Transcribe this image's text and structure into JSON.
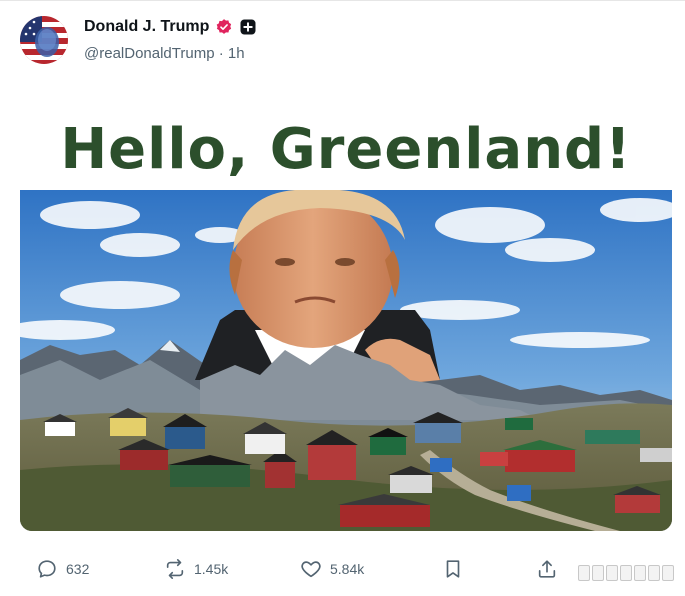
{
  "post": {
    "author": {
      "display_name": "Donald J. Trump",
      "handle": "@realDonaldTrump",
      "separator": "·",
      "time": "1h",
      "avatar_icon": "flag-portrait-avatar",
      "verified_icon": "verified-badge-icon",
      "extra_badge_icon": "plus-badge-icon"
    },
    "media": {
      "headline": "Hello, Greenland!",
      "headline_color": "#2c4f2c",
      "description_icons": [
        "sky",
        "mountains",
        "town",
        "portrait"
      ]
    },
    "actions": {
      "reply": {
        "icon": "reply-icon",
        "count": "632"
      },
      "repost": {
        "icon": "repost-icon",
        "count": "1.45k"
      },
      "like": {
        "icon": "heart-icon",
        "count": "5.84k"
      },
      "bookmark": {
        "icon": "bookmark-icon"
      },
      "share": {
        "icon": "share-icon"
      }
    }
  },
  "colors": {
    "verified_pink": "#e0245e",
    "muted_text": "#536471",
    "primary_text": "#0f1419"
  }
}
